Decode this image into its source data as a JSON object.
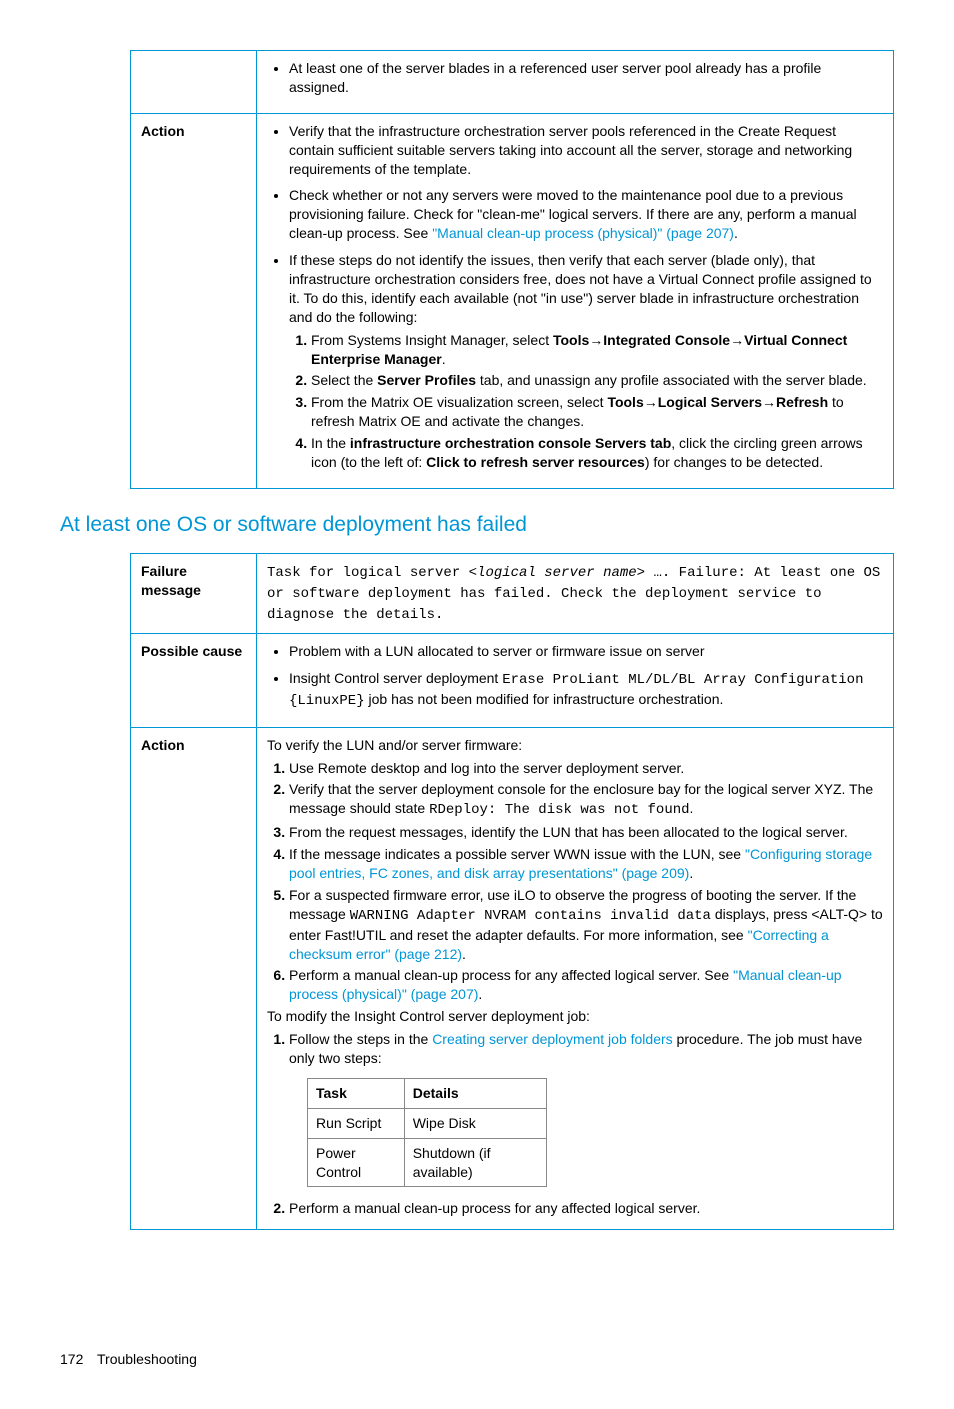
{
  "table1": {
    "row0": {
      "label": "",
      "bullets": [
        "At least one of the server blades in a referenced user server pool already has a profile assigned."
      ]
    },
    "row1": {
      "label": "Action",
      "bullet1": "Verify that the infrastructure orchestration server pools referenced in the Create Request contain sufficient suitable servers taking into account all the server, storage and networking requirements of the template.",
      "bullet2_a": "Check whether or not any servers were moved to the maintenance pool due to a previous provisioning failure. Check for \"clean-me\" logical servers. If there are any, perform a manual clean-up process. See ",
      "bullet2_link": "\"Manual clean-up process (physical)\" (page 207)",
      "bullet2_b": ".",
      "bullet3": "If these steps do not identify the issues, then verify that each server (blade only), that infrastructure orchestration considers free, does not have a Virtual Connect profile assigned to it. To do this, identify each available (not \"in use\") server blade in infrastructure orchestration and do the following:",
      "step1_a": "From Systems Insight Manager, select ",
      "step1_b": "Tools",
      "step1_c": "Integrated Console",
      "step1_d": "Virtual Connect Enterprise Manager",
      "step1_e": ".",
      "step2_a": "Select the ",
      "step2_b": "Server Profiles",
      "step2_c": " tab, and unassign any profile associated with the server blade.",
      "step3_a": "From the Matrix OE visualization screen, select ",
      "step3_b": "Tools",
      "step3_c": "Logical Servers",
      "step3_d": "Refresh",
      "step3_e": " to refresh Matrix OE and activate the changes.",
      "step4_a": "In the ",
      "step4_b": "infrastructure orchestration console Servers tab",
      "step4_c": ", click the circling green arrows icon (to the left of: ",
      "step4_d": "Click to refresh server resources",
      "step4_e": ") for changes to be detected."
    }
  },
  "heading": "At least one OS or software deployment has failed",
  "table2": {
    "row0": {
      "label": "Failure message",
      "msg_a": "Task for logical server ",
      "msg_b": "<logical server name>",
      "msg_c": " …. Failure: At least one OS or software deployment has failed. Check the deployment service to diagnose the details."
    },
    "row1": {
      "label": "Possible cause",
      "bullet1": "Problem with a LUN allocated to server or firmware issue on server",
      "bullet2_a": "Insight Control server deployment ",
      "bullet2_b": "Erase ProLiant ML/DL/BL Array Configuration {LinuxPE}",
      "bullet2_c": " job has not been modified for infrastructure orchestration."
    },
    "row2": {
      "label": "Action",
      "intro1": "To verify the LUN and/or server firmware:",
      "s1": "Use Remote desktop and log into the server deployment server.",
      "s2_a": "Verify that the server deployment console for the enclosure bay for the logical server XYZ. The message should state ",
      "s2_b": "RDeploy: The disk was not found",
      "s2_c": ".",
      "s3": "From the request messages, identify the LUN that has been allocated to the logical server.",
      "s4_a": "If the message indicates a possible server WWN issue with the LUN, see ",
      "s4_link": "\"Configuring storage pool entries, FC zones, and disk array presentations\" (page 209)",
      "s4_b": ".",
      "s5_a": "For a suspected firmware error, use iLO to observe the progress of booting the server. If the message ",
      "s5_b": "WARNING Adapter NVRAM contains invalid data",
      "s5_c": " displays, press <ALT-Q> to enter Fast!UTIL and reset the adapter defaults. For more information, see ",
      "s5_link": "\"Correcting a checksum error\" (page 212)",
      "s5_d": ".",
      "s6_a": "Perform a manual clean-up process for any affected logical server. See ",
      "s6_link": "\"Manual clean-up process (physical)\" (page 207)",
      "s6_b": ".",
      "intro2": "To modify the Insight Control server deployment job:",
      "m1_a": "Follow the steps in the ",
      "m1_link": "Creating server deployment job folders",
      "m1_b": " procedure. The job must have only two steps:",
      "tbl": {
        "h1": "Task",
        "h2": "Details",
        "r1c1": "Run Script",
        "r1c2": "Wipe Disk",
        "r2c1": "Power Control",
        "r2c2": "Shutdown (if available)"
      },
      "m2": "Perform a manual clean-up process for any affected logical server."
    }
  },
  "footer": {
    "page": "172",
    "section": "Troubleshooting"
  }
}
